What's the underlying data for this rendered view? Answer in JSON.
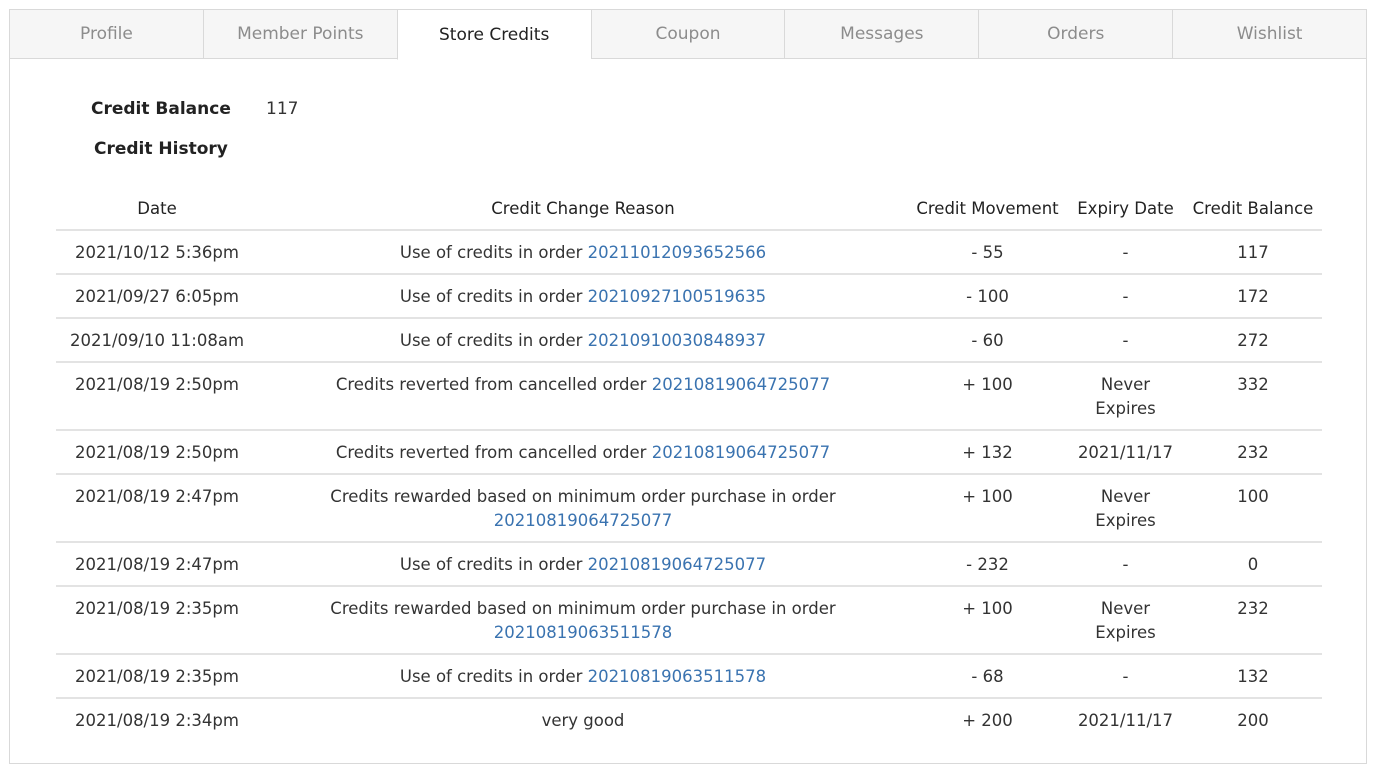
{
  "tabs": [
    {
      "label": "Profile",
      "active": false
    },
    {
      "label": "Member Points",
      "active": false
    },
    {
      "label": "Store Credits",
      "active": true
    },
    {
      "label": "Coupon",
      "active": false
    },
    {
      "label": "Messages",
      "active": false
    },
    {
      "label": "Orders",
      "active": false
    },
    {
      "label": "Wishlist",
      "active": false
    }
  ],
  "summary": {
    "balance_label": "Credit Balance",
    "balance_value": "117",
    "history_label": "Credit History"
  },
  "table": {
    "headers": [
      "Date",
      "Credit Change Reason",
      "Credit Movement",
      "Expiry Date",
      "Credit Balance"
    ],
    "rows": [
      {
        "date": "2021/10/12 5:36pm",
        "reason": "Use of credits in order ",
        "order": "20211012093652566",
        "movement": "- 55",
        "expiry": "-",
        "balance": "117"
      },
      {
        "date": "2021/09/27 6:05pm",
        "reason": "Use of credits in order ",
        "order": "20210927100519635",
        "movement": "- 100",
        "expiry": "-",
        "balance": "172"
      },
      {
        "date": "2021/09/10 11:08am",
        "reason": "Use of credits in order ",
        "order": "20210910030848937",
        "movement": "- 60",
        "expiry": "-",
        "balance": "272"
      },
      {
        "date": "2021/08/19 2:50pm",
        "reason": "Credits reverted from cancelled order ",
        "order": "20210819064725077",
        "movement": "+ 100",
        "expiry": "Never Expires",
        "balance": "332"
      },
      {
        "date": "2021/08/19 2:50pm",
        "reason": "Credits reverted from cancelled order ",
        "order": "20210819064725077",
        "movement": "+ 132",
        "expiry": "2021/11/17",
        "balance": "232"
      },
      {
        "date": "2021/08/19 2:47pm",
        "reason": "Credits rewarded based on minimum order purchase in order ",
        "order": "20210819064725077",
        "movement": "+ 100",
        "expiry": "Never Expires",
        "balance": "100"
      },
      {
        "date": "2021/08/19 2:47pm",
        "reason": "Use of credits in order ",
        "order": "20210819064725077",
        "movement": "- 232",
        "expiry": "-",
        "balance": "0"
      },
      {
        "date": "2021/08/19 2:35pm",
        "reason": "Credits rewarded based on minimum order purchase in order ",
        "order": "20210819063511578",
        "movement": "+ 100",
        "expiry": "Never Expires",
        "balance": "232"
      },
      {
        "date": "2021/08/19 2:35pm",
        "reason": "Use of credits in order ",
        "order": "20210819063511578",
        "movement": "- 68",
        "expiry": "-",
        "balance": "132"
      },
      {
        "date": "2021/08/19 2:34pm",
        "reason": "very good",
        "order": "",
        "movement": "+ 200",
        "expiry": "2021/11/17",
        "balance": "200"
      }
    ]
  },
  "colors": {
    "link": "#3a73b0",
    "border": "#d9d9d9",
    "inactive_tab_text": "#8c8c8c"
  }
}
